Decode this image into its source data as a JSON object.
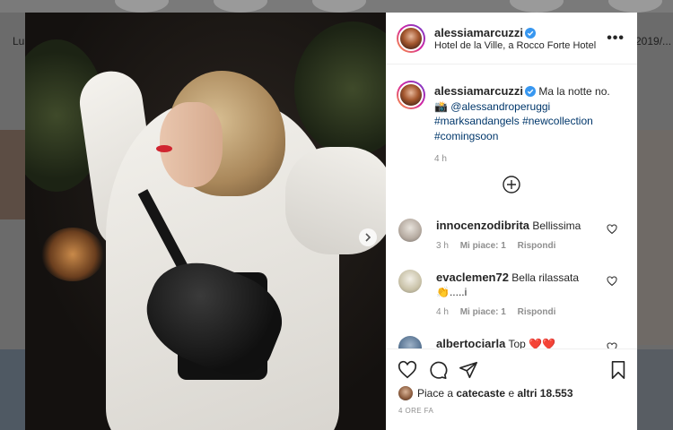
{
  "background": {
    "left_label": "Lu",
    "right_label": "2019/..."
  },
  "post": {
    "username": "alessiamarcuzzi",
    "location": "Hotel de la Ville, a Rocco Forte Hotel",
    "more_label": "•••",
    "caption": {
      "username": "alessiamarcuzzi",
      "text": "Ma la notte no.",
      "emoji": "📸",
      "mention": "@alessandroperuggi",
      "hashtags": [
        "#marksandangels",
        "#newcollection",
        "#comingsoon"
      ],
      "time": "4 h"
    },
    "comments": [
      {
        "username": "innocenzodibrita",
        "text": "Bellissima",
        "time": "3 h",
        "likes": "Mi piace: 1",
        "reply": "Rispondi"
      },
      {
        "username": "evaclemen72",
        "text": "Bella rilassata 👏.....i",
        "time": "4 h",
        "likes": "Mi piace: 1",
        "reply": "Rispondi"
      },
      {
        "username": "albertociarla",
        "text": "Top ❤️❤️",
        "time": "",
        "likes": "",
        "reply": ""
      }
    ],
    "likes": {
      "prefix": "Piace a",
      "user": "catecaste",
      "mid": "e",
      "others": "altri 18.553"
    },
    "posted_ago": "4 ORE FA"
  },
  "colors": {
    "link": "#00376b",
    "verified": "#3897f0",
    "muted": "#8e8e8e"
  }
}
